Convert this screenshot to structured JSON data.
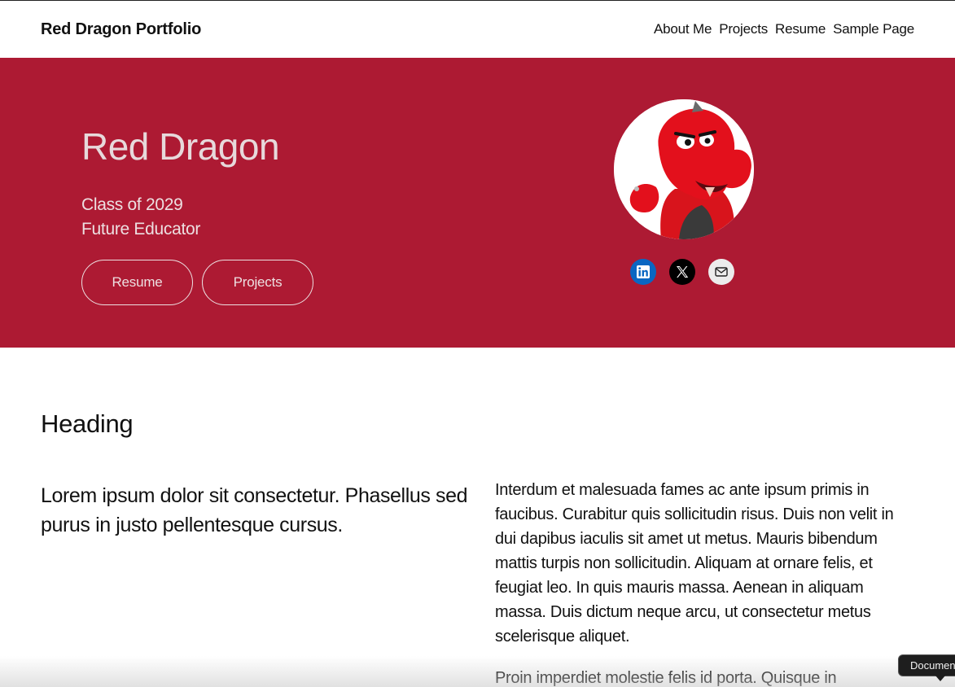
{
  "header": {
    "site_title": "Red Dragon Portfolio",
    "nav": [
      "About Me",
      "Projects",
      "Resume",
      "Sample Page"
    ]
  },
  "hero": {
    "name": "Red Dragon",
    "subtitle_line1": "Class of 2029",
    "subtitle_line2": "Future Educator",
    "buttons": {
      "resume": "Resume",
      "projects": "Projects"
    },
    "socials": [
      "linkedin-icon",
      "x-icon",
      "mail-icon"
    ],
    "colors": {
      "background": "#ad1a33",
      "text": "#e7d9db",
      "linkedin": "#0a66c2"
    }
  },
  "content": {
    "heading": "Heading",
    "lead": "Lorem ipsum dolor sit consectetur. Phasellus sed purus in justo pellentesque cursus.",
    "paragraphs": [
      "Interdum et malesuada fames ac ante ipsum primis in faucibus. Curabitur quis sollicitudin risus. Duis non velit in dui dapibus iaculis sit amet ut metus. Mauris bibendum mattis turpis non sollicitudin. Aliquam at ornare felis, et feugiat leo. In quis mauris massa. Aenean in aliquam massa. Duis dictum neque arcu, ut consectetur metus scelerisque aliquet.",
      "Proin imperdiet molestie felis id porta. Quisque in"
    ]
  },
  "tooltip": {
    "text": "Document"
  }
}
